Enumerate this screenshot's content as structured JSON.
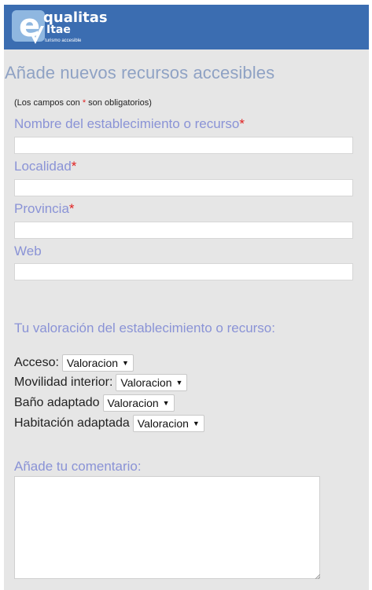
{
  "header": {
    "logo_letter": "e",
    "logo_line1": "qualitas",
    "logo_line2": "Itae",
    "logo_tagline": "turismo accesible"
  },
  "page_title": "Añade nuevos recursos accesibles",
  "required_note": {
    "before": "(Los campos con ",
    "star": "*",
    "after": " son obligatorios)"
  },
  "fields": [
    {
      "label": "Nombre del establecimiento o recurso",
      "required": "*",
      "value": "",
      "placeholder": ""
    },
    {
      "label": "Localidad",
      "required": "*",
      "value": "",
      "placeholder": ""
    },
    {
      "label": "Provincia",
      "required": "*",
      "value": "",
      "placeholder": ""
    },
    {
      "label": "Web",
      "required": "",
      "value": "",
      "placeholder": ""
    }
  ],
  "rating_heading": "Tu valoración del establecimiento o recurso:",
  "ratings": [
    {
      "label": "Acceso:",
      "selected": "Valoracion"
    },
    {
      "label": "Movilidad interior:",
      "selected": "Valoracion"
    },
    {
      "label": "Baño adaptado",
      "selected": "Valoracion"
    },
    {
      "label": "Habitación adaptada",
      "selected": "Valoracion"
    }
  ],
  "comment": {
    "label": "Añade tu comentario:",
    "value": ""
  },
  "icons": {
    "dropdown": "triangle-down-icon",
    "logo_check": "checkmark-icon",
    "resize": "resize-grip-icon"
  },
  "colors": {
    "header": "#3b6db1",
    "label": "#8a93d6",
    "title": "#8fa2c4",
    "required": "#e02020",
    "page_bg": "#e6e6e6"
  }
}
